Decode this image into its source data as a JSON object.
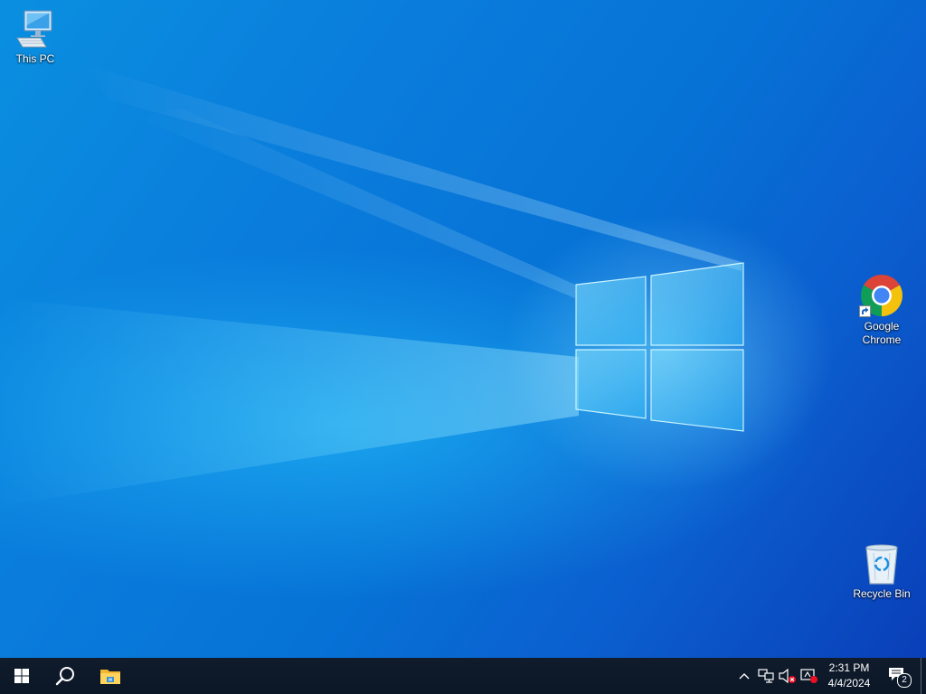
{
  "desktop": {
    "icons": [
      {
        "name": "this-pc",
        "label": "This PC"
      },
      {
        "name": "google-chrome",
        "label": "Google Chrome"
      },
      {
        "name": "recycle-bin",
        "label": "Recycle Bin"
      }
    ]
  },
  "taskbar": {
    "start_icon": "windows-logo-icon",
    "search_icon": "search-icon",
    "pinned": [
      {
        "icon": "file-explorer-icon"
      }
    ],
    "tray": {
      "icons": [
        "chevron-up-icon",
        "network-icon",
        "volume-muted-icon",
        "notification-alert-icon"
      ],
      "time": "2:31 PM",
      "date": "4/4/2024",
      "action_center_count": "2"
    }
  },
  "colors": {
    "desktop_blue": "#0672d6",
    "taskbar": "#0d1a2b",
    "chrome_red": "#db4437",
    "chrome_yellow": "#f4c20d",
    "chrome_green": "#0f9d58",
    "chrome_blue": "#4285f4"
  }
}
